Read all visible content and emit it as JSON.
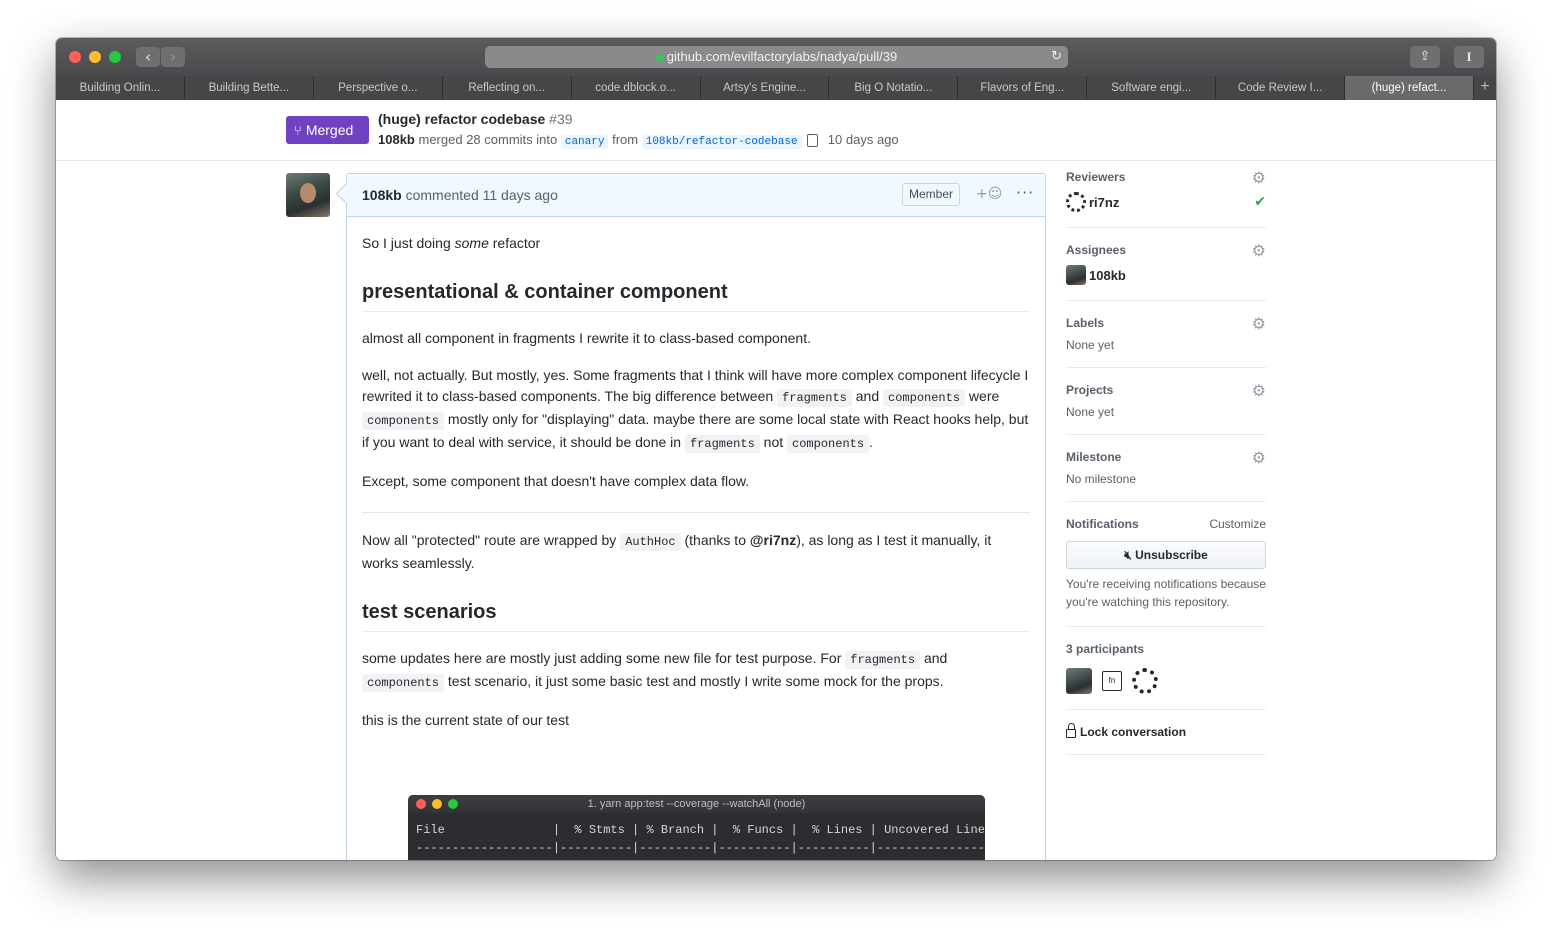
{
  "browser": {
    "url": "github.com/evilfactorylabs/nadya/pull/39",
    "tabs": [
      {
        "label": "Building Onlin...",
        "active": false
      },
      {
        "label": "Building Bette...",
        "active": false
      },
      {
        "label": "Perspective o...",
        "active": false
      },
      {
        "label": "Reflecting on...",
        "active": false
      },
      {
        "label": "code.dblock.o...",
        "active": false
      },
      {
        "label": "Artsy's Engine...",
        "active": false
      },
      {
        "label": "Big O Notatio...",
        "active": false
      },
      {
        "label": "Flavors of Eng...",
        "active": false
      },
      {
        "label": "Software engi...",
        "active": false
      },
      {
        "label": "Code Review I...",
        "active": false
      },
      {
        "label": "(huge) refact...",
        "active": true
      }
    ],
    "reader_label": "I"
  },
  "pr": {
    "status": "Merged",
    "title": "(huge) refactor codebase",
    "number": "#39",
    "author": "108kb",
    "merged_text": "merged 28 commits into",
    "base_branch": "canary",
    "from_text": "from",
    "head_branch": "108kb/refactor-codebase",
    "time_ago": "10 days ago"
  },
  "comment": {
    "author": "108kb",
    "action": "commented 11 days ago",
    "badge": "Member",
    "react_label": "+☺",
    "more_label": "···",
    "intro_pre": "So I just doing ",
    "intro_em": "some",
    "intro_post": " refactor",
    "h_presentational": "presentational & container component",
    "p1": "almost all component in fragments I rewrite it to class-based component.",
    "p2_a": "well, not actually. But mostly, yes. Some fragments that I think will have more complex component lifecycle I rewrited it to class-based components. The big difference between ",
    "code_fragments": "fragments",
    "p2_b": " and ",
    "code_components": "components",
    "p2_c": " were ",
    "p2_d": " mostly only for \"displaying\" data. maybe there are some local state with React hooks help, but if you want to deal with service, it should be done in ",
    "p2_e": " not ",
    "p2_f": ".",
    "p3": "Except, some component that doesn't have complex data flow.",
    "p4_a": "Now all \"protected\" route are wrapped by ",
    "code_authhoc": "AuthHoc",
    "p4_b": " (thanks to ",
    "mention": "@ri7nz",
    "p4_c": "), as long as I test it manually, it works seamlessly.",
    "h_test": "test scenarios",
    "p5_a": "some updates here are mostly just adding some new file for test purpose. For ",
    "p5_b": " and ",
    "p5_c": " test scenario, it just some basic test and mostly I write some mock for the props.",
    "p6": "this is the current state of our test"
  },
  "terminal": {
    "title": "1. yarn app:test --coverage --watchAll (node)",
    "header": "File               |  % Stmts | % Branch |  % Funcs |  % Lines | Uncovered Line #s |",
    "separator": "-------------------|----------|----------|----------|----------|-------------------|"
  },
  "sidebar": {
    "reviewers_title": "Reviewers",
    "reviewer": "ri7nz",
    "assignees_title": "Assignees",
    "assignee": "108kb",
    "labels_title": "Labels",
    "labels_value": "None yet",
    "projects_title": "Projects",
    "projects_value": "None yet",
    "milestone_title": "Milestone",
    "milestone_value": "No milestone",
    "notifications_title": "Notifications",
    "customize": "Customize",
    "unsubscribe": "Unsubscribe",
    "notif_text": "You're receiving notifications because you're watching this repository.",
    "participants_title": "3 participants",
    "participant_box_label": "fn",
    "lock": "Lock conversation"
  },
  "colors": {
    "merged": "#6f42c1",
    "link": "#0366d6",
    "check": "#28a745"
  }
}
